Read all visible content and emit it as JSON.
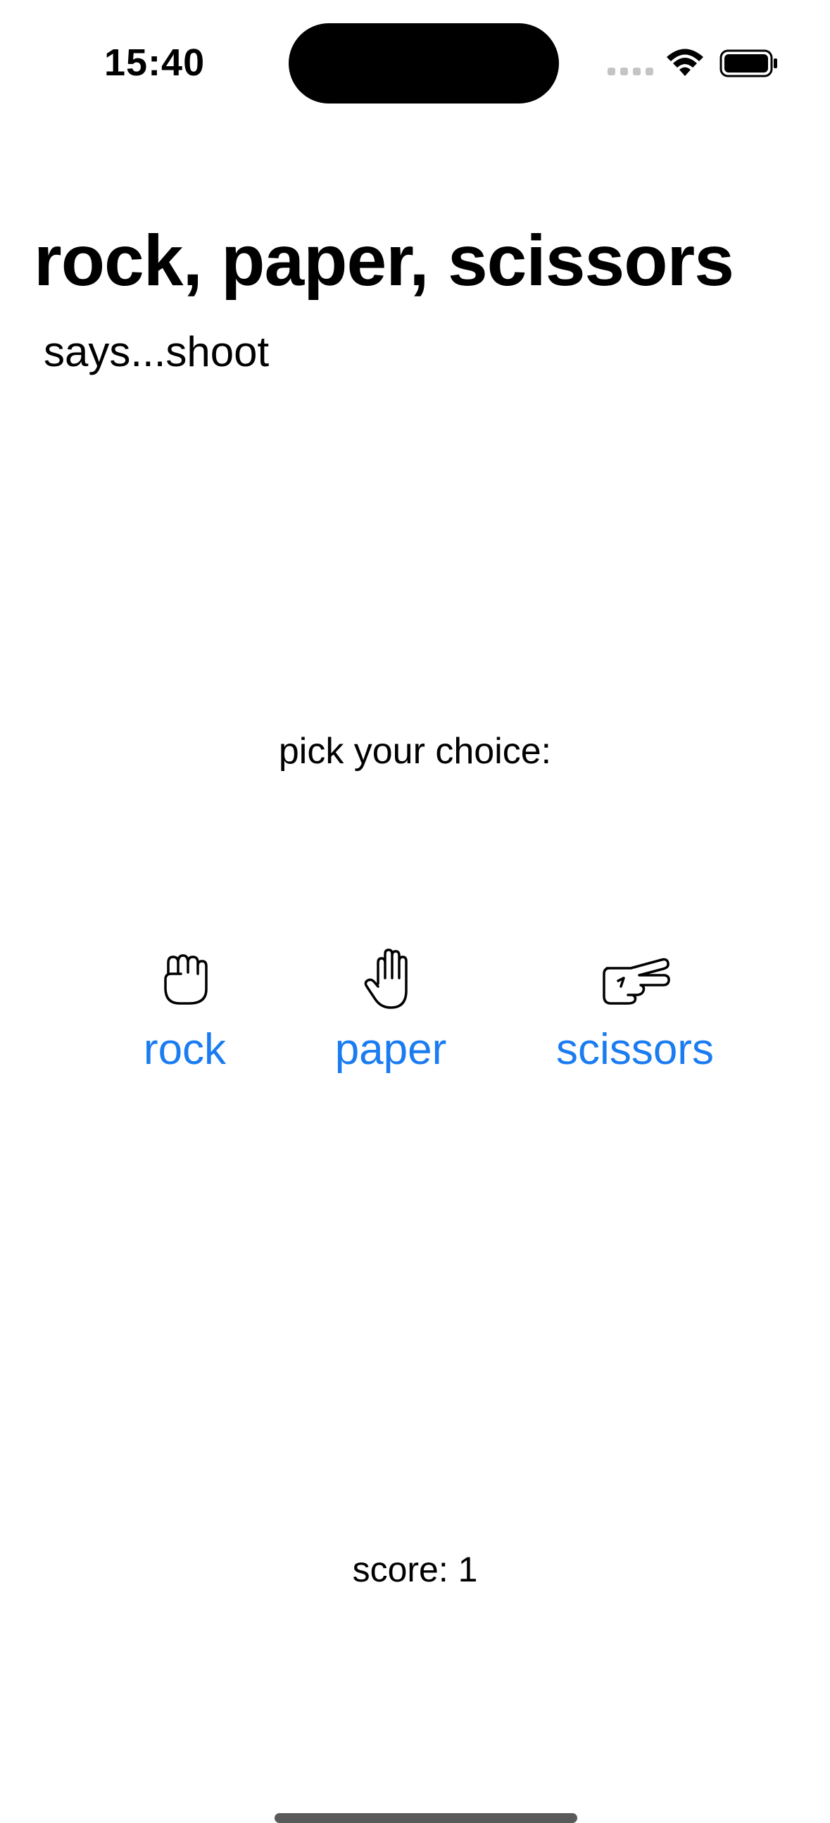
{
  "status_bar": {
    "time": "15:40",
    "icons": [
      "cellular-signal-icon",
      "wifi-icon",
      "battery-icon"
    ]
  },
  "header": {
    "title": "rock, paper, scissors",
    "subtitle": "says...shoot"
  },
  "prompt": "pick your choice:",
  "choices": [
    {
      "label": "rock",
      "icon": "fist-icon"
    },
    {
      "label": "paper",
      "icon": "raised-hand-icon"
    },
    {
      "label": "scissors",
      "icon": "peace-hand-icon"
    }
  ],
  "score": {
    "text": "score: 1"
  },
  "colors": {
    "accent": "#1a7cf0",
    "text": "#000000",
    "background": "#ffffff"
  }
}
